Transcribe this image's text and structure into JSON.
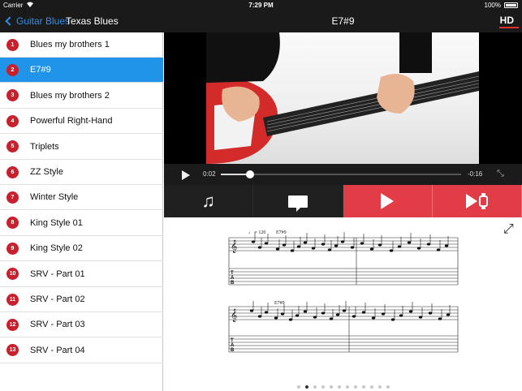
{
  "statusbar": {
    "carrier": "Carrier",
    "time": "7:29 PM",
    "battery": "100%"
  },
  "navbar": {
    "back_label": "Guitar Blues",
    "left_title": "Texas Blues",
    "title": "E7#9",
    "hd_label": "HD"
  },
  "lessons": [
    {
      "num": "1",
      "label": "Blues my brothers 1"
    },
    {
      "num": "2",
      "label": "E7#9"
    },
    {
      "num": "3",
      "label": "Blues my brothers 2"
    },
    {
      "num": "4",
      "label": "Powerful Right-Hand"
    },
    {
      "num": "5",
      "label": "Triplets"
    },
    {
      "num": "6",
      "label": "ZZ Style"
    },
    {
      "num": "7",
      "label": "Winter Style"
    },
    {
      "num": "8",
      "label": "King Style 01"
    },
    {
      "num": "9",
      "label": "King Style 02"
    },
    {
      "num": "10",
      "label": "SRV - Part 01"
    },
    {
      "num": "11",
      "label": "SRV - Part 02"
    },
    {
      "num": "12",
      "label": "SRV - Part 03"
    },
    {
      "num": "13",
      "label": "SRV - Part 04"
    }
  ],
  "selected_index": 1,
  "player": {
    "elapsed": "0:02",
    "remaining": "-0:16",
    "progress": 0.12
  },
  "score": {
    "tempo": "♩ = 120",
    "chord": "E7#9",
    "tab_label": "T\nA\nB",
    "page_count": 12,
    "page_active": 1
  },
  "icons": {
    "note": "music-note-icon",
    "comment": "speech-bubble-icon",
    "play": "play-icon",
    "watch": "play-watch-icon",
    "fullscreen": "fullscreen-icon",
    "back": "chevron-left-icon"
  },
  "colors": {
    "accent": "#1f94e8",
    "red": "#e23c46",
    "badge": "#c8202c"
  }
}
